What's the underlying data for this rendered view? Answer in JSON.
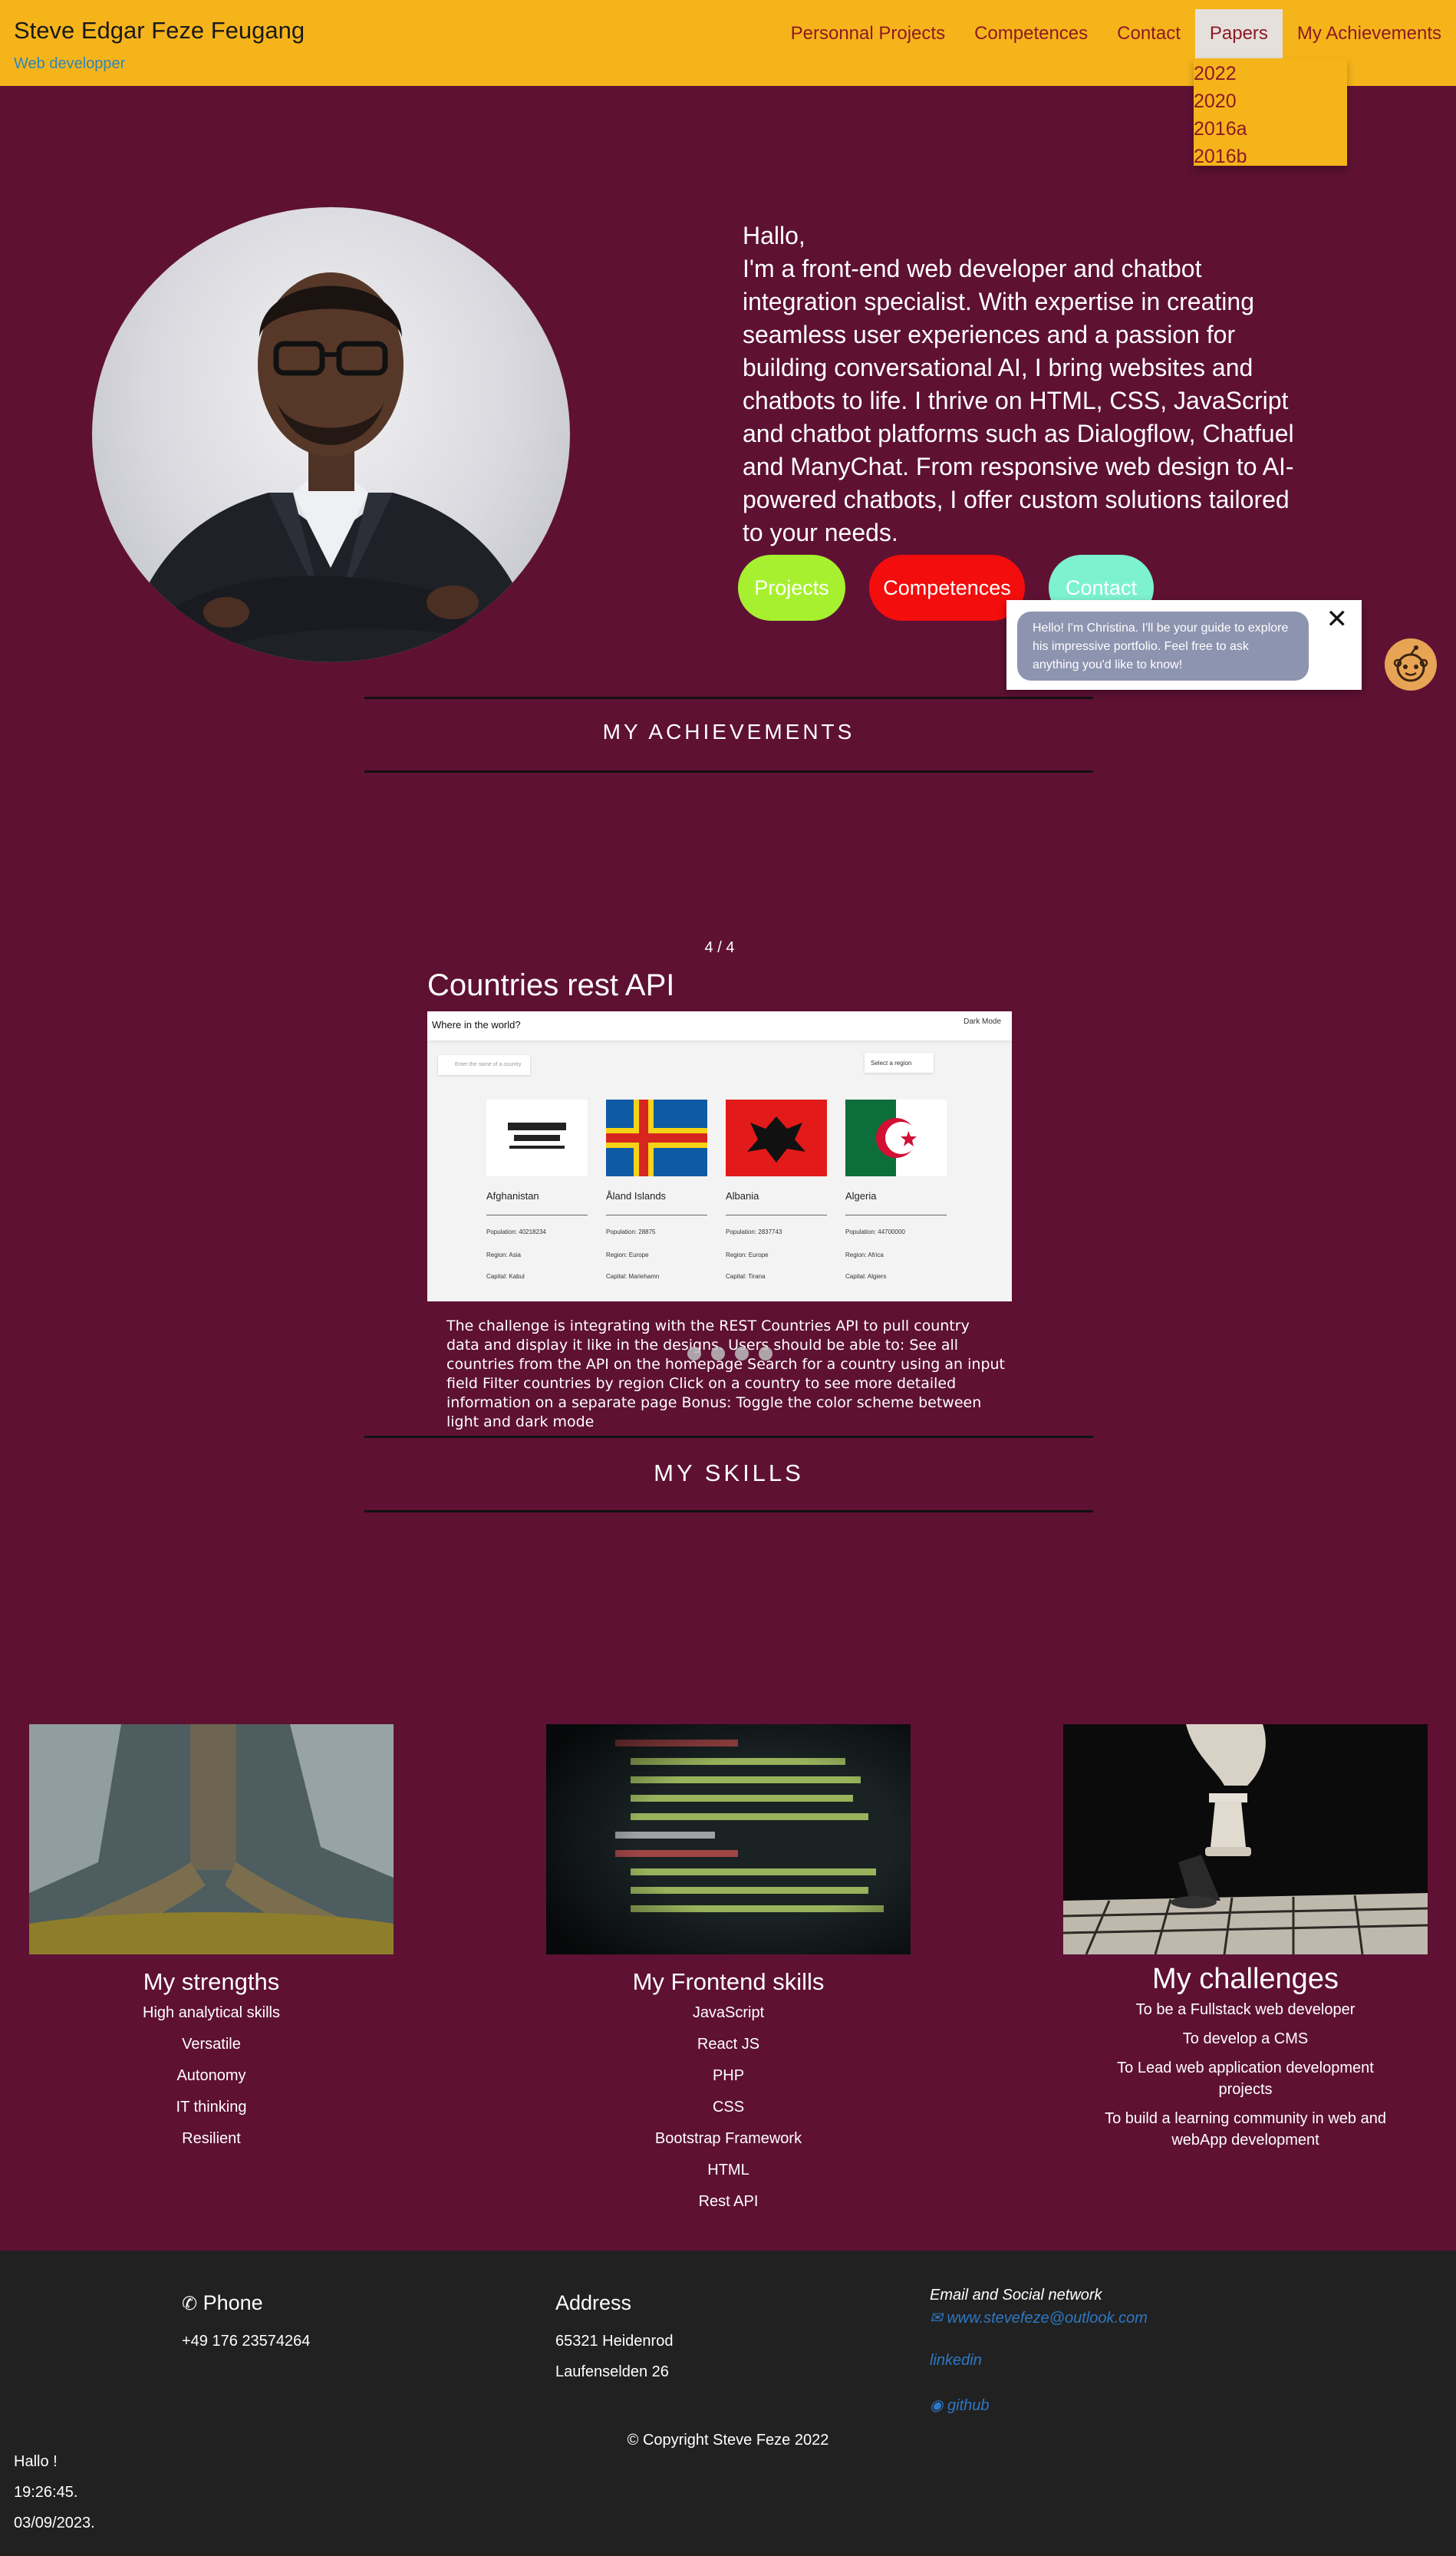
{
  "header": {
    "title": "Steve Edgar Feze Feugang",
    "subtitle": "Web developper",
    "nav": [
      "Personnal Projects",
      "Competences",
      "Contact",
      "Papers",
      "My Achievements"
    ],
    "papers_dropdown": [
      "2022",
      "2020",
      "2016a",
      "2016b"
    ]
  },
  "hero": {
    "greeting": "Hallo,",
    "intro": "I'm a front-end web developer and chatbot integration specialist. With expertise in creating seamless user experiences and a passion for building conversational AI, I bring websites and chatbots to life. I thrive on HTML, CSS, JavaScript and chatbot platforms such as Dialogflow, Chatfuel and ManyChat. From responsive web design to AI-powered chatbots, I offer custom solutions tailored to your needs.",
    "buttons": [
      "Projects",
      "Competences",
      "Contact"
    ]
  },
  "chat": {
    "message": "Hello! I'm Christina. I'll be your guide to explore his impressive portfolio. Feel free to ask anything you'd like to know!",
    "close": "✕"
  },
  "achievements": {
    "heading": "MY ACHIEVEMENTS",
    "counter": "4 / 4",
    "slide_title": "Countries rest API",
    "screenshot": {
      "brand": "Where in the world?",
      "mode": "Dark Mode",
      "search_placeholder": "Enter the name of a country",
      "region_select": "Select a region",
      "countries": [
        {
          "name": "Afghanistan",
          "population": "Population: 40218234",
          "region": "Region: Asia",
          "capital": "Capital: Kabul"
        },
        {
          "name": "Åland Islands",
          "population": "Population: 28875",
          "region": "Region: Europe",
          "capital": "Capital: Mariehamn"
        },
        {
          "name": "Albania",
          "population": "Population: 2837743",
          "region": "Region: Europe",
          "capital": "Capital: Tirana"
        },
        {
          "name": "Algeria",
          "population": "Population: 44700000",
          "region": "Region: Africa",
          "capital": "Capital: Algiers"
        }
      ]
    },
    "description": "The challenge is integrating with the REST Countries API to pull country data and display it like in the designs. Users should be able to: See all countries from the API on the homepage Search for a country using an input field Filter countries by region Click on a country to see more detailed information on a separate page Bonus: Toggle the color scheme between light and dark mode"
  },
  "skills": {
    "heading": "MY SKILLS",
    "columns": [
      {
        "title": "My strengths",
        "items": [
          "High analytical skills",
          "Versatile",
          "Autonomy",
          "IT thinking",
          "Resilient"
        ]
      },
      {
        "title": "My Frontend skills",
        "items": [
          "JavaScript",
          "React JS",
          "PHP",
          "CSS",
          "Bootstrap Framework",
          "HTML",
          "Rest API"
        ]
      },
      {
        "title": "My challenges",
        "items": [
          "To be a Fullstack web developer",
          "To develop a CMS",
          "To Lead web application development projects",
          "To build a learning community in web and webApp development"
        ]
      }
    ]
  },
  "footer": {
    "phone_heading": "Phone",
    "phone": "+49 176 23574264",
    "address_heading": "Address",
    "address_line1": "65321 Heidenrod",
    "address_line2": "Laufenselden 26",
    "social_heading": "Email and Social network",
    "email": "www.stevefeze@outlook.com",
    "linkedin": "linkedin",
    "github": "github",
    "copyright": "© Copyright Steve Feze 2022",
    "greeting": "Hallo !",
    "time": "19:26:45.",
    "date": "03/09/2023."
  },
  "colors": {
    "header_bg": "#f6b41b",
    "page_bg": "#5e1133",
    "nav_text": "#8b1a25",
    "btn_projects": "#a7f02f",
    "btn_competences": "#f30d0d",
    "btn_contact": "#7df2cf",
    "footer_bg": "#212121",
    "link": "#2e78c4"
  }
}
